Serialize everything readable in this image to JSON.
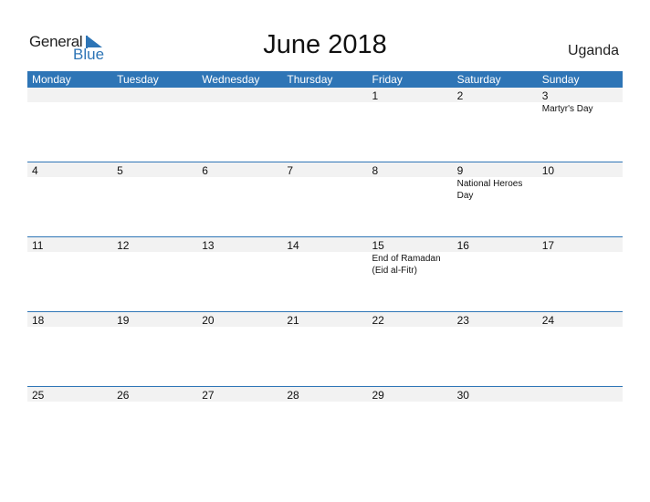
{
  "logo": {
    "text_general": "General",
    "text_blue": "Blue"
  },
  "title": "June 2018",
  "country": "Uganda",
  "colors": {
    "accent": "#2e75b6",
    "row_bar": "#f2f2f2"
  },
  "weekdays": [
    "Monday",
    "Tuesday",
    "Wednesday",
    "Thursday",
    "Friday",
    "Saturday",
    "Sunday"
  ],
  "weeks": [
    {
      "days": [
        "",
        "",
        "",
        "",
        "1",
        "2",
        "3"
      ],
      "events": [
        "",
        "",
        "",
        "",
        "",
        "",
        "Martyr's Day"
      ]
    },
    {
      "days": [
        "4",
        "5",
        "6",
        "7",
        "8",
        "9",
        "10"
      ],
      "events": [
        "",
        "",
        "",
        "",
        "",
        "National Heroes Day",
        ""
      ]
    },
    {
      "days": [
        "11",
        "12",
        "13",
        "14",
        "15",
        "16",
        "17"
      ],
      "events": [
        "",
        "",
        "",
        "",
        "End of Ramadan (Eid al-Fitr)",
        "",
        ""
      ]
    },
    {
      "days": [
        "18",
        "19",
        "20",
        "21",
        "22",
        "23",
        "24"
      ],
      "events": [
        "",
        "",
        "",
        "",
        "",
        "",
        ""
      ]
    },
    {
      "days": [
        "25",
        "26",
        "27",
        "28",
        "29",
        "30",
        ""
      ],
      "events": [
        "",
        "",
        "",
        "",
        "",
        "",
        ""
      ]
    }
  ]
}
